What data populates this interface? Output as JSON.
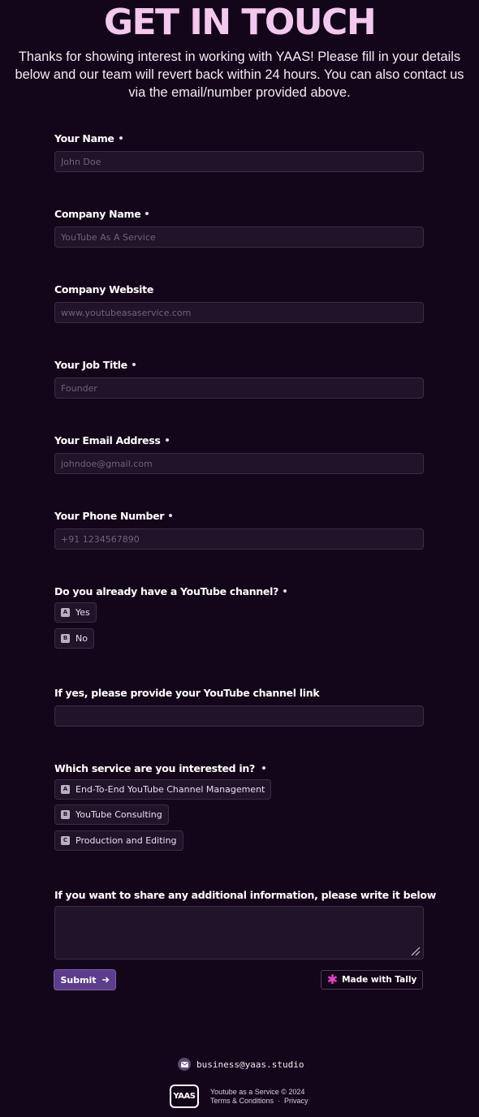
{
  "hero": {
    "title": "GET IN TOUCH",
    "intro": "Thanks for showing interest in working with YAAS! Please fill in your details below and our team will revert back within 24 hours. You can also contact us via the email/number provided above."
  },
  "form": {
    "name": {
      "label": "Your Name",
      "placeholder": "John Doe",
      "required": true
    },
    "company": {
      "label": "Company Name",
      "placeholder": "YouTube As A Service",
      "required": true
    },
    "website": {
      "label": "Company Website",
      "placeholder": "www.youtubeasaservice.com",
      "required": false
    },
    "job_title": {
      "label": "Your Job Title",
      "placeholder": "Founder",
      "required": true
    },
    "email": {
      "label": "Your Email Address",
      "placeholder": "johndoe@gmail.com",
      "required": true
    },
    "phone": {
      "label": "Your Phone Number",
      "placeholder": "+91 1234567890",
      "required": true
    },
    "has_channel": {
      "label": "Do you already have a YouTube channel?",
      "required": true,
      "options": [
        {
          "key": "A",
          "label": "Yes"
        },
        {
          "key": "B",
          "label": "No"
        }
      ]
    },
    "channel_link": {
      "label": "If yes, please provide your YouTube channel link",
      "placeholder": "",
      "required": false
    },
    "service": {
      "label": "Which service are you interested in?",
      "required": true,
      "options": [
        {
          "key": "A",
          "label": "End-To-End YouTube Channel Management"
        },
        {
          "key": "B",
          "label": "YouTube Consulting"
        },
        {
          "key": "C",
          "label": "Production and Editing"
        }
      ]
    },
    "additional": {
      "label": "If you want to share any additional information, please write it below"
    },
    "submit_label": "Submit",
    "tally_label": "Made with Tally"
  },
  "footer": {
    "email": "business@yaas.studio",
    "logo_text": "YAAS",
    "copyright": "Youtube as a Service © 2024",
    "terms": "Terms & Conditions",
    "separator": "·",
    "privacy": "Privacy"
  },
  "colors": {
    "background": "#14061a",
    "title": "#f3c8ef",
    "submit": "#5b3d8c",
    "tally_accent": "#e640c8"
  },
  "icons": [
    "arrow-right-icon",
    "tally-star-icon",
    "mail-icon",
    "resize-handle-icon"
  ]
}
